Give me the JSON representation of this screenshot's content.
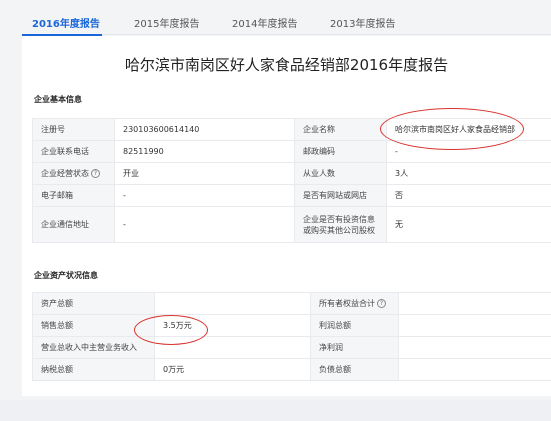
{
  "tabs": [
    {
      "label": "2016年度报告",
      "active": true
    },
    {
      "label": "2015年度报告",
      "active": false
    },
    {
      "label": "2014年度报告",
      "active": false
    },
    {
      "label": "2013年度报告",
      "active": false
    }
  ],
  "title": "哈尔滨市南岗区好人家食品经销部2016年度报告",
  "basic": {
    "section_title": "企业基本信息",
    "rows": [
      {
        "l1": "注册号",
        "v1": "230103600614140",
        "l2": "企业名称",
        "v2": "哈尔滨市南岗区好人家食品经销部"
      },
      {
        "l1": "企业联系电话",
        "v1": "82511990",
        "l2": "邮政编码",
        "v2": "-"
      },
      {
        "l1": "企业经营状态",
        "v1": "开业",
        "l2": "从业人数",
        "v2": "3人"
      },
      {
        "l1": "电子邮箱",
        "v1": "-",
        "l2": "是否有网站或网店",
        "v2": "否"
      },
      {
        "l1": "企业通信地址",
        "v1": "-",
        "l2": "企业是否有投资信息或购买其他公司股权",
        "v2": "无"
      }
    ]
  },
  "assets": {
    "section_title": "企业资产状况信息",
    "rows": [
      {
        "l1": "资产总额",
        "v1": "",
        "l2": "所有者权益合计",
        "v2": ""
      },
      {
        "l1": "销售总额",
        "v1": "3.5万元",
        "l2": "利润总额",
        "v2": ""
      },
      {
        "l1": "营业总收入中主营业务收入",
        "v1": "",
        "l2": "净利润",
        "v2": ""
      },
      {
        "l1": "纳税总额",
        "v1": "0万元",
        "l2": "负债总额",
        "v2": ""
      }
    ]
  },
  "colors": {
    "accent": "#1a66d8",
    "annotation": "#d9322c"
  },
  "icons": {
    "info": "info-circle-icon"
  }
}
